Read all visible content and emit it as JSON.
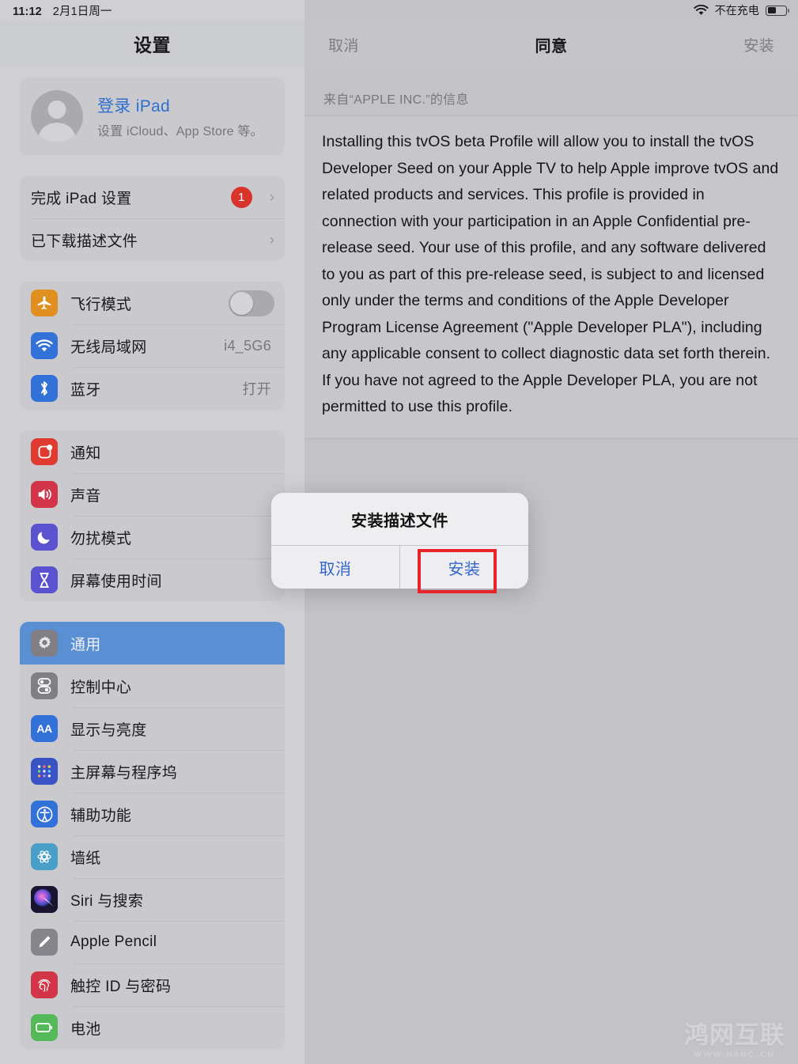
{
  "status_bar": {
    "time": "11:12",
    "date": "2月1日周一",
    "wifi_icon": "wifi-icon",
    "charging_text": "不在充电",
    "battery_icon": "battery-icon"
  },
  "sidebar": {
    "title": "设置",
    "account": {
      "title": "登录 iPad",
      "subtitle": "设置 iCloud、App Store 等。",
      "avatar_icon": "person-avatar-icon"
    },
    "setup_group": [
      {
        "label": "完成 iPad 设置",
        "badge": "1",
        "chevron": "›"
      },
      {
        "label": "已下载描述文件",
        "chevron": "›"
      }
    ],
    "connectivity_group": [
      {
        "label": "飞行模式",
        "icon": "airplane-icon",
        "icon_color": "#e09020",
        "control": "toggle",
        "toggle_on": false
      },
      {
        "label": "无线局域网",
        "icon": "wifi-icon",
        "icon_color": "#3272d8",
        "value": "i4_5G6"
      },
      {
        "label": "蓝牙",
        "icon": "bluetooth-icon",
        "icon_color": "#3272d8",
        "value": "打开"
      }
    ],
    "alerts_group": [
      {
        "label": "通知",
        "icon": "notifications-icon",
        "icon_color": "#e03b30"
      },
      {
        "label": "声音",
        "icon": "sound-icon",
        "icon_color": "#d2354a"
      },
      {
        "label": "勿扰模式",
        "icon": "moon-icon",
        "icon_color": "#5a52cf"
      },
      {
        "label": "屏幕使用时间",
        "icon": "hourglass-icon",
        "icon_color": "#5a52cf"
      }
    ],
    "system_group": [
      {
        "label": "通用",
        "icon": "gear-icon",
        "icon_color": "#7f7f85",
        "selected": true
      },
      {
        "label": "控制中心",
        "icon": "control-center-icon",
        "icon_color": "#7f7f85"
      },
      {
        "label": "显示与亮度",
        "icon": "display-aa-icon",
        "icon_color": "#3272d8"
      },
      {
        "label": "主屏幕与程序坞",
        "icon": "home-screen-icon",
        "icon_color": "#3a53c4"
      },
      {
        "label": "辅助功能",
        "icon": "accessibility-icon",
        "icon_color": "#3272d8"
      },
      {
        "label": "墙纸",
        "icon": "wallpaper-icon",
        "icon_color": "#4a9fc8"
      },
      {
        "label": "Siri 与搜索",
        "icon": "siri-icon",
        "icon_color": "#2b1f3a"
      },
      {
        "label": "Apple Pencil",
        "icon": "pencil-icon",
        "icon_color": "#85858b"
      },
      {
        "label": "触控 ID 与密码",
        "icon": "touch-id-icon",
        "icon_color": "#d23548"
      },
      {
        "label": "电池",
        "icon": "battery-icon",
        "icon_color": "#55b95a"
      }
    ]
  },
  "detail": {
    "nav": {
      "cancel_label": "取消",
      "title": "同意",
      "install_label": "安装"
    },
    "section_header": "来自“APPLE INC.”的信息",
    "body_text": "Installing this tvOS beta Profile will allow you to install the tvOS Developer Seed on your Apple TV to help Apple improve tvOS and related products and services. This profile is provided in connection with your participation in an Apple Confidential pre-release seed. Your use of this profile, and any software delivered to you as part of this pre-release seed, is subject to and licensed only under the terms and conditions of the Apple Developer Program License Agreement (\"Apple Developer PLA\"), including any applicable consent to collect diagnostic data set forth therein. If you have not agreed to the Apple Developer PLA, you are not permitted to use this profile."
  },
  "alert": {
    "title": "安装描述文件",
    "cancel_label": "取消",
    "confirm_label": "安装",
    "highlight_color": "#e8242a"
  },
  "watermark": {
    "main": "鸿网互联",
    "sub": "WWW.H8HC.CN"
  }
}
